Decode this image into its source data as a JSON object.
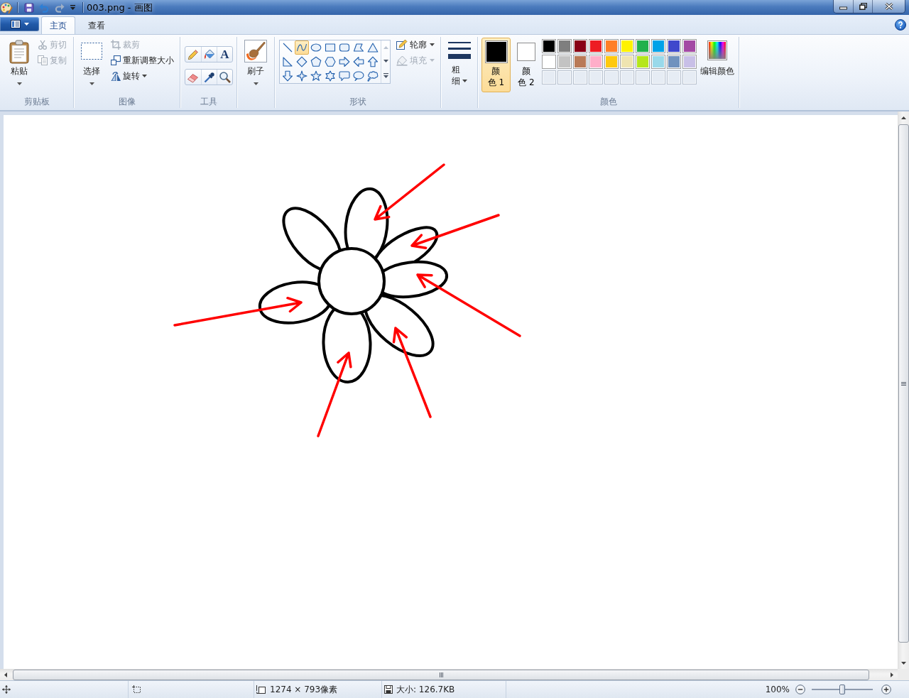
{
  "window": {
    "title": "003.png - 画图"
  },
  "quick_access": [
    {
      "kind": "save",
      "disabled": false
    },
    {
      "kind": "undo",
      "disabled": false
    },
    {
      "kind": "redo",
      "disabled": true
    }
  ],
  "tabs": [
    {
      "label": "主页",
      "selected": true
    },
    {
      "label": "查看",
      "selected": false
    }
  ],
  "ribbon": {
    "clipboard": {
      "label": "剪贴板",
      "paste": "粘贴",
      "actions": [
        {
          "kind": "cut",
          "label": "剪切",
          "disabled": true
        },
        {
          "kind": "copy",
          "label": "复制",
          "disabled": true
        }
      ]
    },
    "image": {
      "label": "图像",
      "select": "选择",
      "actions": [
        {
          "kind": "crop",
          "label": "裁剪",
          "disabled": true,
          "dropdown": false
        },
        {
          "kind": "resize",
          "label": "重新调整大小",
          "disabled": false,
          "dropdown": false
        },
        {
          "kind": "rotate",
          "label": "旋转",
          "disabled": false,
          "dropdown": true
        }
      ]
    },
    "tools": {
      "label": "工具",
      "items": [
        {
          "kind": "pencil",
          "selected": false
        },
        {
          "kind": "fill",
          "selected": false
        },
        {
          "kind": "text",
          "glyph": "A",
          "selected": false
        },
        {
          "kind": "eraser",
          "selected": false
        },
        {
          "kind": "picker",
          "selected": false
        },
        {
          "kind": "magnifier",
          "selected": false
        }
      ]
    },
    "brushes": {
      "label": "刷子"
    },
    "shapes": {
      "label": "形状",
      "items": [
        {
          "kind": "line",
          "selected": false
        },
        {
          "kind": "curve",
          "selected": true
        },
        {
          "kind": "oval",
          "selected": false
        },
        {
          "kind": "rectangle",
          "selected": false
        },
        {
          "kind": "rounded-rectangle",
          "selected": false
        },
        {
          "kind": "polygon",
          "selected": false
        },
        {
          "kind": "triangle",
          "selected": false
        },
        {
          "kind": "right-triangle",
          "selected": false
        },
        {
          "kind": "diamond",
          "selected": false
        },
        {
          "kind": "pentagon",
          "selected": false
        },
        {
          "kind": "hexagon",
          "selected": false
        },
        {
          "kind": "arrow-right",
          "selected": false
        },
        {
          "kind": "arrow-left",
          "selected": false
        },
        {
          "kind": "arrow-up",
          "selected": false
        },
        {
          "kind": "arrow-down",
          "selected": false
        },
        {
          "kind": "star-four",
          "selected": false
        },
        {
          "kind": "star-five",
          "selected": false
        },
        {
          "kind": "star-six",
          "selected": false
        },
        {
          "kind": "callout-rectangle",
          "selected": false
        },
        {
          "kind": "callout-oval",
          "selected": false
        },
        {
          "kind": "callout-cloud",
          "selected": false
        }
      ],
      "outline": {
        "label": "轮廓",
        "disabled": false
      },
      "fill": {
        "label": "填充",
        "disabled": true
      }
    },
    "size": {
      "label": "粗细"
    },
    "colors": {
      "label": "颜色",
      "color1": {
        "label": "颜色 1",
        "color": "#000000",
        "selected": true
      },
      "color2": {
        "label": "颜色 2",
        "color": "#ffffff",
        "selected": false
      },
      "palette": [
        {
          "kind": "swatch",
          "color": "#000000"
        },
        {
          "kind": "swatch",
          "color": "#7f7f7f"
        },
        {
          "kind": "swatch",
          "color": "#880015"
        },
        {
          "kind": "swatch",
          "color": "#ed1c24"
        },
        {
          "kind": "swatch",
          "color": "#ff7f27"
        },
        {
          "kind": "swatch",
          "color": "#fff200"
        },
        {
          "kind": "swatch",
          "color": "#22b14c"
        },
        {
          "kind": "swatch",
          "color": "#00a2e8"
        },
        {
          "kind": "swatch",
          "color": "#3f48cc"
        },
        {
          "kind": "swatch",
          "color": "#a349a4"
        },
        {
          "kind": "swatch",
          "color": "#ffffff"
        },
        {
          "kind": "swatch",
          "color": "#c3c3c3"
        },
        {
          "kind": "swatch",
          "color": "#b97a57"
        },
        {
          "kind": "swatch",
          "color": "#ffaec9"
        },
        {
          "kind": "swatch",
          "color": "#ffc90e"
        },
        {
          "kind": "swatch",
          "color": "#efe4b0"
        },
        {
          "kind": "swatch",
          "color": "#b5e61d"
        },
        {
          "kind": "swatch",
          "color": "#99d9ea"
        },
        {
          "kind": "swatch",
          "color": "#7092be"
        },
        {
          "kind": "swatch",
          "color": "#c8bfe7"
        },
        {
          "kind": "empty"
        },
        {
          "kind": "empty"
        },
        {
          "kind": "empty"
        },
        {
          "kind": "empty"
        },
        {
          "kind": "empty"
        },
        {
          "kind": "empty"
        },
        {
          "kind": "empty"
        },
        {
          "kind": "empty"
        },
        {
          "kind": "empty"
        },
        {
          "kind": "empty"
        }
      ],
      "edit": "编辑颜色"
    }
  },
  "status_bar": {
    "dimensions": "1274 × 793像素",
    "file_size": "大小: 126.7KB",
    "zoom": "100%",
    "zoom_slider": {
      "level": 0.5
    }
  }
}
